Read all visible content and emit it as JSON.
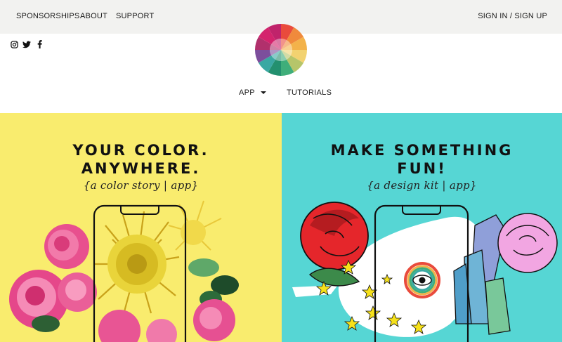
{
  "topnav": {
    "sponsorships": "SPONSORSHIPS",
    "about": "ABOUT",
    "support": "SUPPORT",
    "sign_in": "SIGN IN / SIGN UP"
  },
  "social": {
    "icons": [
      "instagram-icon",
      "twitter-icon",
      "facebook-icon"
    ]
  },
  "logo": {
    "colors": [
      "#e94b3c",
      "#f08a3c",
      "#f3b24a",
      "#f2d270",
      "#b6c56a",
      "#3fae7a",
      "#23906f",
      "#3aa8a3",
      "#7c4e9c",
      "#b1306c",
      "#d4236d",
      "#c0236b"
    ]
  },
  "subnav": {
    "app": "APP",
    "tutorials": "TUTORIALS"
  },
  "panels": {
    "left": {
      "line1": "YOUR COLOR.",
      "line2": "ANYWHERE.",
      "tagline": "{a color story | app}",
      "bg": "#f9ec6e"
    },
    "right": {
      "line1": "MAKE SOMETHING",
      "line2": "FUN!",
      "tagline": "{a design kit | app}",
      "bg": "#56d6d4"
    }
  }
}
